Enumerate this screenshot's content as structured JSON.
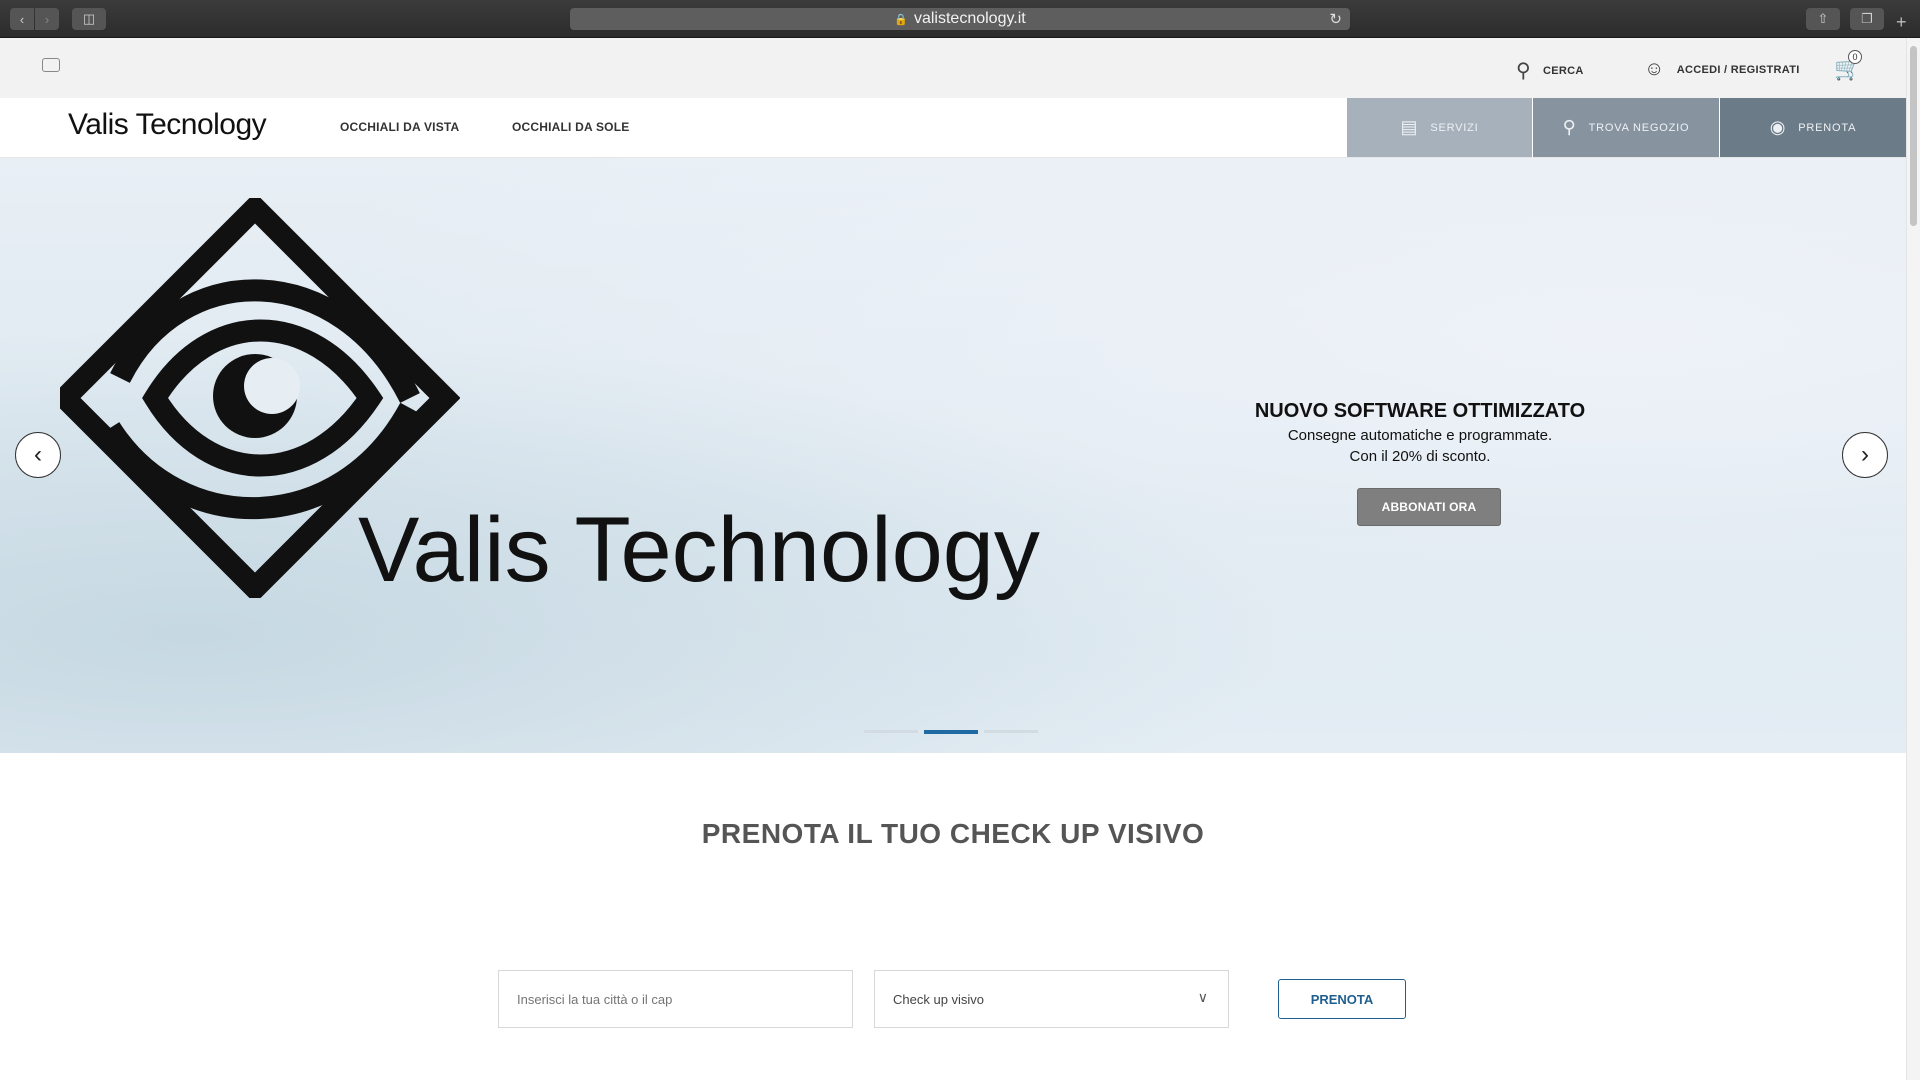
{
  "browser": {
    "url": "valistecnology.it"
  },
  "utility": {
    "search_label": "CERCA",
    "account_label": "ACCEDI / REGISTRATI",
    "cart_count": "0"
  },
  "nav": {
    "logo": "Valis Tecnology",
    "links": [
      "OCCHIALI DA VISTA",
      "OCCHIALI DA SOLE"
    ],
    "tiles": {
      "servizi": "SERVIZI",
      "trova": "TROVA NEGOZIO",
      "prenota": "PRENOTA"
    }
  },
  "hero": {
    "brand": "Valis Technology",
    "title": "NUOVO SOFTWARE OTTIMIZZATO",
    "line1": "Consegne automatiche e programmate.",
    "line2": "Con il 20% di sconto.",
    "cta": "ABBONATI ORA",
    "active_slide": 2,
    "slide_count": 3
  },
  "booking": {
    "title": "PRENOTA IL TUO CHECK UP VISIVO",
    "city_placeholder": "Inserisci la tua città o il cap",
    "service_selected": "Check up visivo",
    "submit": "PRENOTA"
  },
  "icons": {
    "search": "search-icon",
    "user": "user-icon",
    "cart": "cart-icon",
    "chat": "chat-icon",
    "document": "document-icon",
    "pin": "map-pin-icon",
    "eye": "eye-icon"
  },
  "colors": {
    "accent": "#1f6aa0",
    "tile_servizi": "#a6b1bb",
    "tile_trova": "#8794a0",
    "tile_prenota": "#6c7b88",
    "cta": "#7f7f7f"
  }
}
